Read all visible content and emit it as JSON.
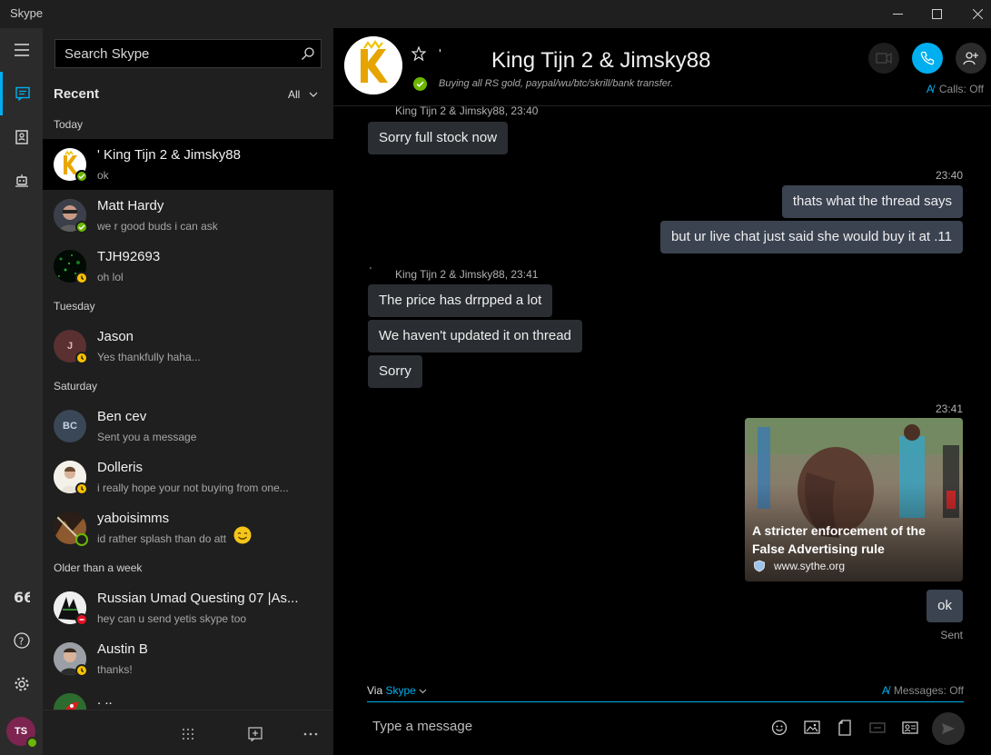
{
  "app": {
    "title": "Skype"
  },
  "search": {
    "placeholder": "Search Skype"
  },
  "recent": {
    "title": "Recent",
    "filter": "All"
  },
  "conversations": {
    "today": "Today",
    "tuesday": "Tuesday",
    "saturday": "Saturday",
    "older": "Older than a week",
    "items": [
      {
        "name": "'          King Tijn 2 & Jimsky88",
        "preview": "ok",
        "status": "online"
      },
      {
        "name": "Matt Hardy",
        "preview": "we r good buds i can ask",
        "status": "online"
      },
      {
        "name": "TJH92693",
        "preview": "oh lol",
        "status": "away"
      },
      {
        "name": "Jason",
        "preview": "Yes thankfully haha...",
        "status": "away",
        "initials": "J"
      },
      {
        "name": "Ben cev",
        "preview": "Sent you a message",
        "initials": "BC"
      },
      {
        "name": "Dolleris",
        "preview": "i really hope your not buying from one...",
        "status": "away"
      },
      {
        "name": "yaboisimms",
        "preview": "id rather splash than do att",
        "status": "offline"
      },
      {
        "name": "Russian Umad Questing 07 |As...",
        "preview": "hey can u send yetis skype too",
        "status": "dnd"
      },
      {
        "name": "Austin B",
        "preview": "thanks!",
        "status": "away"
      },
      {
        "name": ". ..",
        "preview": ""
      }
    ]
  },
  "me": {
    "initials": "TS"
  },
  "chat": {
    "title": "King Tijn 2 & Jimsky88",
    "title_prefix": "'",
    "mood": "Buying all RS gold, paypal/wu/btc/skrill/bank transfer.",
    "calls_status": "Calls: Off",
    "messages": {
      "sender1": "King Tijn 2 & Jimsky88, 23:40",
      "m1": "Sorry full stock now",
      "time2": "23:40",
      "m2": "thats what the thread says",
      "m3": "but ur live chat just said she would buy it at .11",
      "sender2": "King Tijn 2 & Jimsky88, 23:41",
      "m4": "The price has drrpped a lot",
      "m5": "We haven't updated it on thread",
      "m6": "Sorry",
      "time3": "23:41",
      "card_title": "A stricter enforcement of the False Advertising rule",
      "card_url": "www.sythe.org",
      "m7": "ok",
      "sent": "Sent"
    },
    "compose": {
      "via": "Via",
      "via_link": "Skype",
      "messages_status": "Messages: Off",
      "placeholder": "Type a message"
    }
  },
  "colors": {
    "accent": "#00aff0",
    "online": "#6bb700",
    "away": "#f8c200",
    "dnd": "#e81123"
  }
}
